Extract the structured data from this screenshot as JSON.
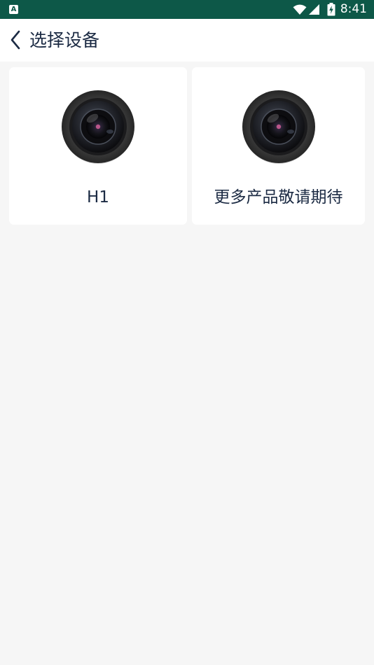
{
  "status_bar": {
    "notification_icon": "a-notification-icon",
    "notification_glyph": "A",
    "wifi_icon": "wifi-icon",
    "signal_icon": "cell-signal-icon",
    "battery_icon": "battery-charging-icon",
    "time": "8:41",
    "background_color": "#0d5848"
  },
  "app_bar": {
    "back_icon": "chevron-left-icon",
    "title": "选择设备"
  },
  "devices": [
    {
      "label": "H1",
      "icon": "camera-lens-icon"
    },
    {
      "label": "更多产品敬请期待",
      "icon": "camera-lens-icon"
    }
  ],
  "colors": {
    "text_primary": "#1b2a43",
    "page_background": "#f6f6f6",
    "card_background": "#ffffff"
  }
}
